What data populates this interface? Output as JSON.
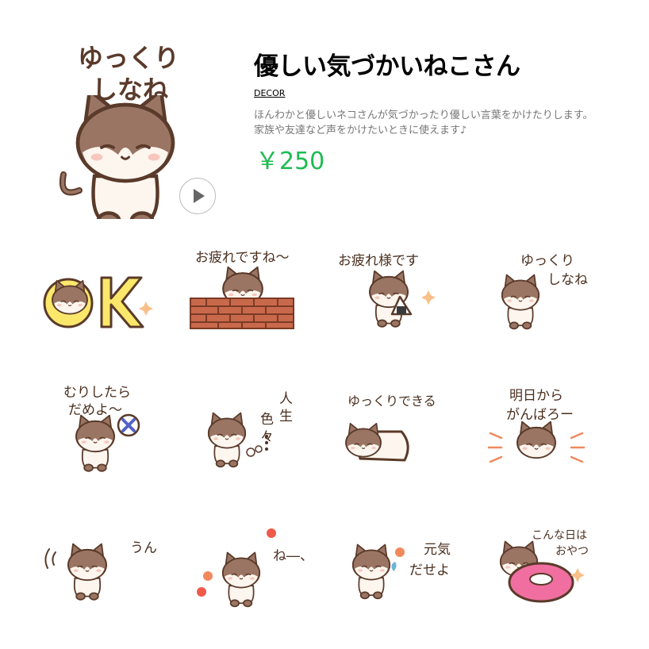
{
  "main_sticker": {
    "caption_line1": "ゆっくり",
    "caption_line2": "しなね"
  },
  "product": {
    "title": "優しい気づかいねこさん",
    "author": "DECOR",
    "description": "ほんわかと優しいネコさんが気づかったり優しい言葉をかけたりします。家族や友達など声をかけたいときに使えます♪",
    "price": "￥250"
  },
  "colors": {
    "price_green": "#1fbb53",
    "cat_brown": "#9a7563",
    "outline": "#5a3a2a"
  },
  "stickers": [
    {
      "caption": "OK"
    },
    {
      "caption": "お疲れですね～"
    },
    {
      "caption": "お疲れ様です"
    },
    {
      "caption_lines": [
        "ゆっくり",
        "しなね"
      ]
    },
    {
      "caption_lines": [
        "むりしたら",
        "だめよ～"
      ]
    },
    {
      "caption_lines": [
        "人",
        "生",
        "色",
        "々"
      ]
    },
    {
      "caption": "ゆっくりできる"
    },
    {
      "caption_lines": [
        "明日から",
        "がんばろー"
      ]
    },
    {
      "caption": "うん"
    },
    {
      "caption": "ね―、"
    },
    {
      "caption_lines": [
        "元気",
        "だせよ"
      ]
    },
    {
      "caption_lines": [
        "こんな日は",
        "おやつ"
      ]
    }
  ]
}
